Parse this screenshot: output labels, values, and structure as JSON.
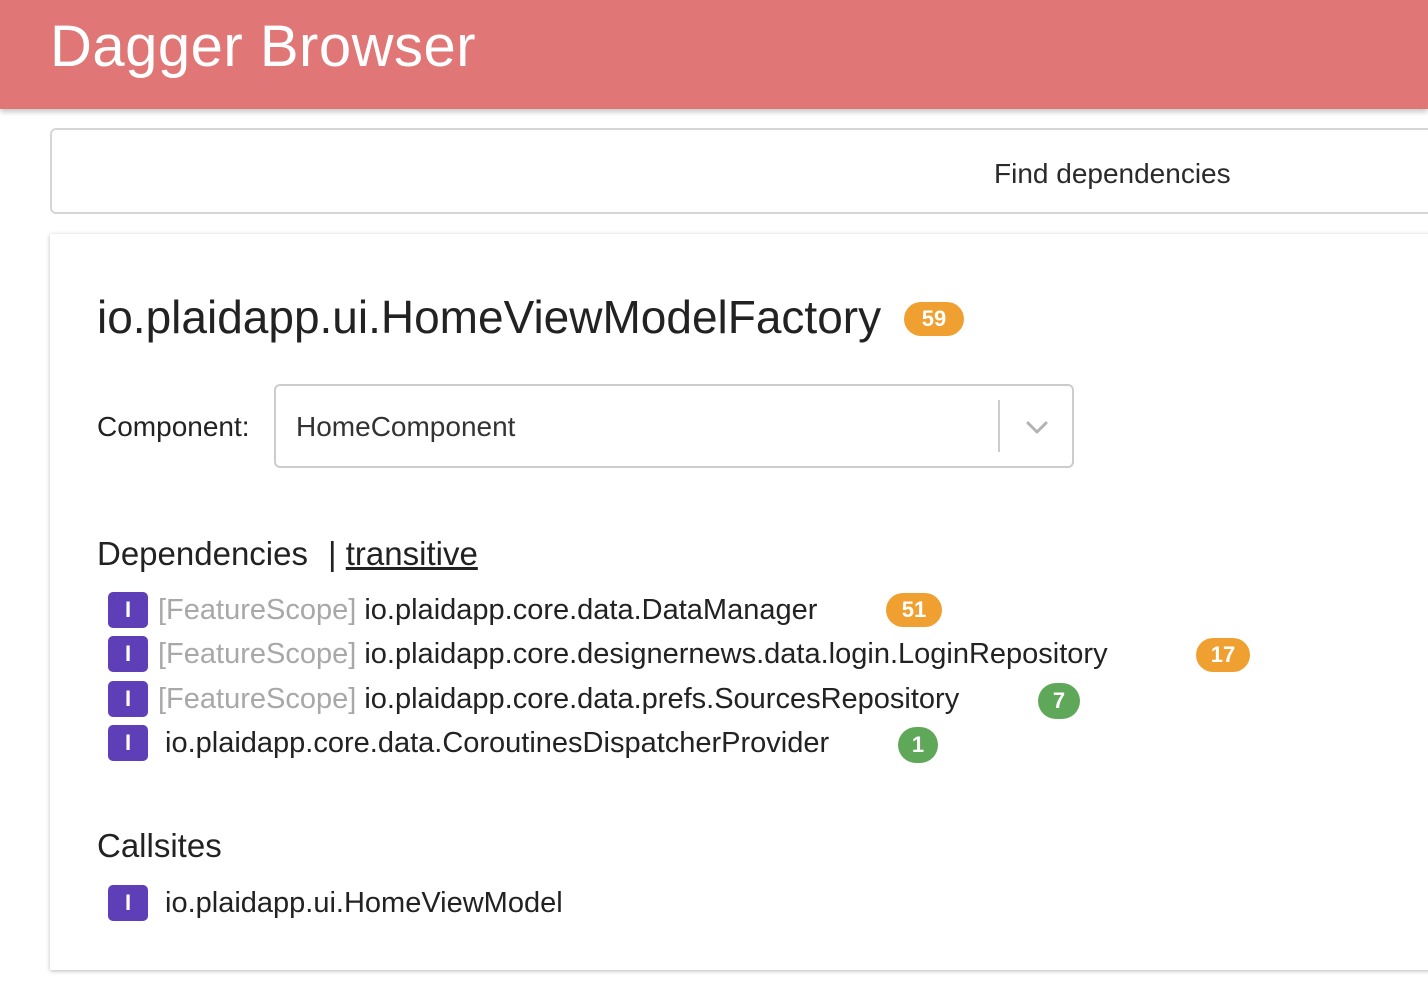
{
  "header": {
    "title": "Dagger Browser",
    "background_color": "#e07676"
  },
  "search": {
    "label": "Find dependencies"
  },
  "binding": {
    "name": "io.plaidapp.ui.HomeViewModelFactory",
    "count": "59",
    "count_color": "#f0a030"
  },
  "component": {
    "label": "Component:",
    "selected": "HomeComponent",
    "chevron_icon": "chevron-down-icon"
  },
  "dependencies": {
    "heading": "Dependencies",
    "separator": "|",
    "transitive_link": "transitive",
    "items": [
      {
        "kind": "I",
        "scope": "[FeatureScope]",
        "name": "io.plaidapp.core.data.DataManager",
        "count": "51",
        "badge_color": "#f0a030"
      },
      {
        "kind": "I",
        "scope": "[FeatureScope]",
        "name": "io.plaidapp.core.designernews.data.login.LoginRepository",
        "count": "17",
        "badge_color": "#f0a030"
      },
      {
        "kind": "I",
        "scope": "[FeatureScope]",
        "name": "io.plaidapp.core.data.prefs.SourcesRepository",
        "count": "7",
        "badge_color": "#5fa85a"
      },
      {
        "kind": "I",
        "scope": "",
        "name": "io.plaidapp.core.data.CoroutinesDispatcherProvider",
        "count": "1",
        "badge_color": "#5fa85a"
      }
    ]
  },
  "callsites": {
    "heading": "Callsites",
    "items": [
      {
        "kind": "I",
        "name": "io.plaidapp.ui.HomeViewModel"
      }
    ]
  },
  "colors": {
    "kind_badge": "#5e3fb7",
    "scope_text": "#a8a8a8"
  }
}
